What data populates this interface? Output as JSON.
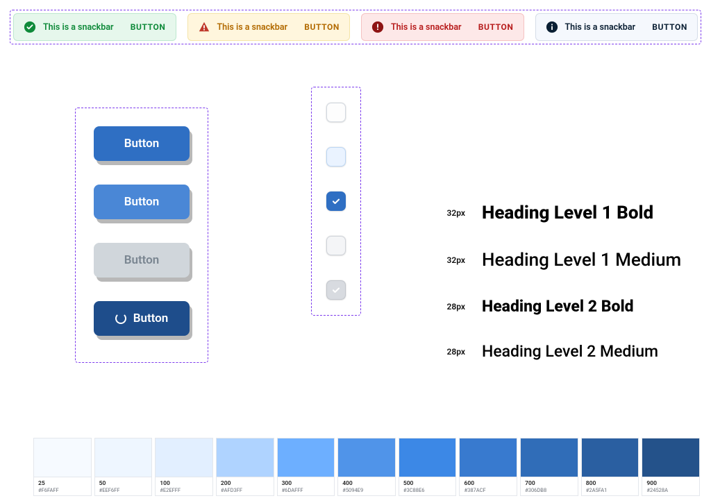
{
  "snackbars": [
    {
      "variant": "success",
      "message": "This is a snackbar",
      "action": "BUTTON"
    },
    {
      "variant": "warning",
      "message": "This is a snackbar",
      "action": "BUTTON"
    },
    {
      "variant": "error",
      "message": "This is a snackbar",
      "action": "BUTTON"
    },
    {
      "variant": "info",
      "message": "This is a snackbar",
      "action": "BUTTON"
    }
  ],
  "buttons": {
    "default_label": "Button",
    "hover_label": "Button",
    "disabled_label": "Button",
    "loading_label": "Button"
  },
  "typography": [
    {
      "size_label": "32px",
      "text": "Heading Level 1 Bold",
      "class": "h1b"
    },
    {
      "size_label": "32px",
      "text": "Heading Level 1 Medium",
      "class": "h1m"
    },
    {
      "size_label": "28px",
      "text": "Heading Level 2 Bold",
      "class": "h2b"
    },
    {
      "size_label": "28px",
      "text": "Heading Level 2 Medium",
      "class": "h2m"
    }
  ],
  "palette": [
    {
      "name": "25",
      "hex": "#F6FAFF",
      "color": "#F6FAFF"
    },
    {
      "name": "50",
      "hex": "#EEF6FF",
      "color": "#EEF6FF"
    },
    {
      "name": "100",
      "hex": "#E2EFFF",
      "color": "#E2EFFF"
    },
    {
      "name": "200",
      "hex": "#AFD3FF",
      "color": "#AFD3FF"
    },
    {
      "name": "300",
      "hex": "#6DAFFF",
      "color": "#6DAFFF"
    },
    {
      "name": "400",
      "hex": "#5094E9",
      "color": "#5094E9"
    },
    {
      "name": "500",
      "hex": "#3C88E6",
      "color": "#3C88E6"
    },
    {
      "name": "600",
      "hex": "#387ACF",
      "color": "#387ACF"
    },
    {
      "name": "700",
      "hex": "#306DB8",
      "color": "#306DB8"
    },
    {
      "name": "800",
      "hex": "#2A5FA1",
      "color": "#2A5FA1"
    },
    {
      "name": "900",
      "hex": "#24528A",
      "color": "#24528A"
    }
  ]
}
